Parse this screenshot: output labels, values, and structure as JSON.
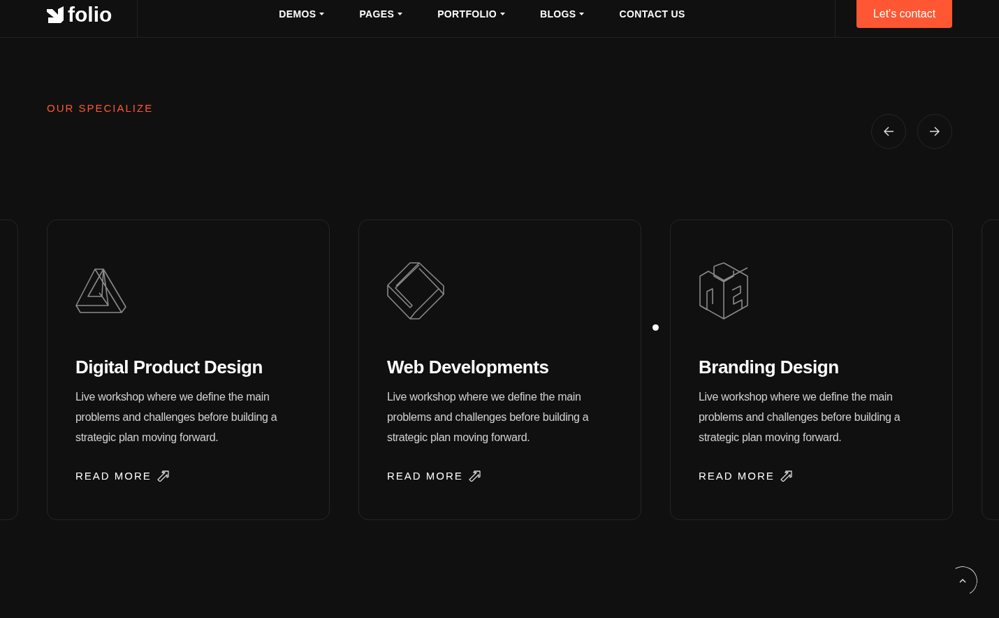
{
  "header": {
    "logo": "folio",
    "nav": [
      {
        "label": "DEMOS",
        "dropdown": true
      },
      {
        "label": "PAGES",
        "dropdown": true
      },
      {
        "label": "PORTFOLIO",
        "dropdown": true
      },
      {
        "label": "BLOGS",
        "dropdown": true
      },
      {
        "label": "CONTACT US",
        "dropdown": false
      }
    ],
    "cta": "Let's contact"
  },
  "section": {
    "eyebrow": "OUR SPECIALIZE",
    "cards": [
      {
        "kind": "triangle",
        "title": "Digital Product Design",
        "text": "Live workshop where we define the main problems and challenges before building a strategic plan moving forward.",
        "link": "READ MORE"
      },
      {
        "kind": "diamond",
        "title": "Web Developments",
        "text": "Live workshop where we define the main problems and challenges before building a strategic plan moving forward.",
        "link": "READ MORE"
      },
      {
        "kind": "cube",
        "title": "Branding Design",
        "text": "Live workshop where we define the main problems and challenges before building a strategic plan moving forward.",
        "link": "READ MORE"
      }
    ]
  }
}
